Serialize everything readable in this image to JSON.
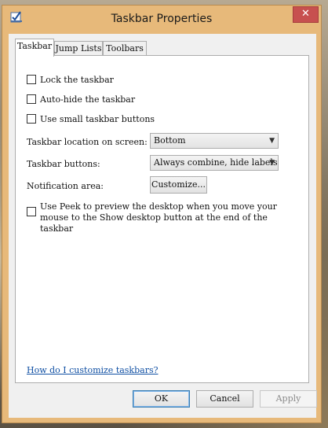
{
  "window": {
    "title": "Taskbar Properties",
    "close_glyph": "✕"
  },
  "tabs": [
    {
      "label": "Taskbar",
      "active": true
    },
    {
      "label": "Jump Lists",
      "active": false
    },
    {
      "label": "Toolbars",
      "active": false
    }
  ],
  "taskbar": {
    "lock_label": "Lock the taskbar",
    "lock_checked": false,
    "autohide_label": "Auto-hide the taskbar",
    "autohide_checked": false,
    "small_buttons_label": "Use small taskbar buttons",
    "small_buttons_checked": false,
    "location_label": "Taskbar location on screen:",
    "location_value": "Bottom",
    "buttons_label": "Taskbar buttons:",
    "buttons_value": "Always combine, hide labels",
    "notification_label": "Notification area:",
    "customize_label": "Customize...",
    "peek_label": "Use Peek to preview the desktop when you move your mouse to the Show desktop button at the end of the taskbar",
    "peek_checked": false,
    "help_link": "How do I customize taskbars?"
  },
  "footer": {
    "ok_label": "OK",
    "cancel_label": "Cancel",
    "apply_label": "Apply"
  },
  "icons": {
    "app": "taskbar-checkbox-icon",
    "dropdown": "chevron-down-icon"
  },
  "colors": {
    "titlebar": "#e7b97a",
    "close": "#c7504f",
    "link": "#0f4fa3"
  }
}
